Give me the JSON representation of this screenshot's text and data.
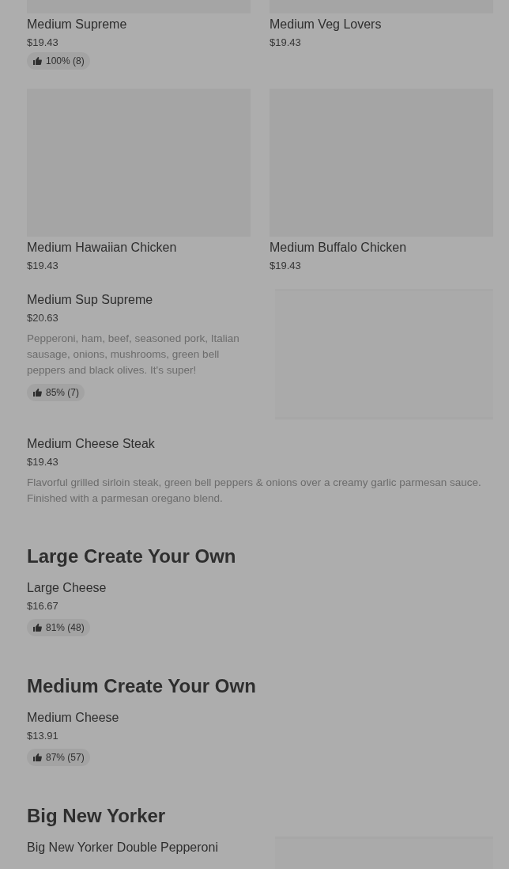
{
  "grid_items": [
    {
      "name": "Medium Supreme",
      "price": "$19.43",
      "rating": "100% (8)"
    },
    {
      "name": "Medium Veg Lovers",
      "price": "$19.43"
    },
    {
      "name": "Medium Hawaiian Chicken",
      "price": "$19.43"
    },
    {
      "name": "Medium Buffalo Chicken",
      "price": "$19.43"
    }
  ],
  "list_items": [
    {
      "name": "Medium Sup Supreme",
      "price": "$20.63",
      "description": "Pepperoni, ham, beef, seasoned pork, Italian sausage, onions, mushrooms, green bell peppers and black olives. It's super!",
      "rating": "85% (7)",
      "has_image": true
    },
    {
      "name": "Medium Cheese Steak",
      "price": "$19.43",
      "description": "Flavorful grilled sirloin steak, green bell peppers & onions over a creamy garlic parmesan sauce. Finished with a parmesan oregano blend."
    }
  ],
  "sections": [
    {
      "title": "Large Create Your Own",
      "items": [
        {
          "name": "Large Cheese",
          "price": "$16.67",
          "rating": "81% (48)"
        }
      ]
    },
    {
      "title": "Medium Create Your Own",
      "items": [
        {
          "name": "Medium Cheese",
          "price": "$13.91",
          "rating": "87% (57)"
        }
      ]
    },
    {
      "title": "Big New Yorker",
      "items": [
        {
          "name": "Big New Yorker Double Pepperoni",
          "has_image": true
        }
      ]
    }
  ]
}
